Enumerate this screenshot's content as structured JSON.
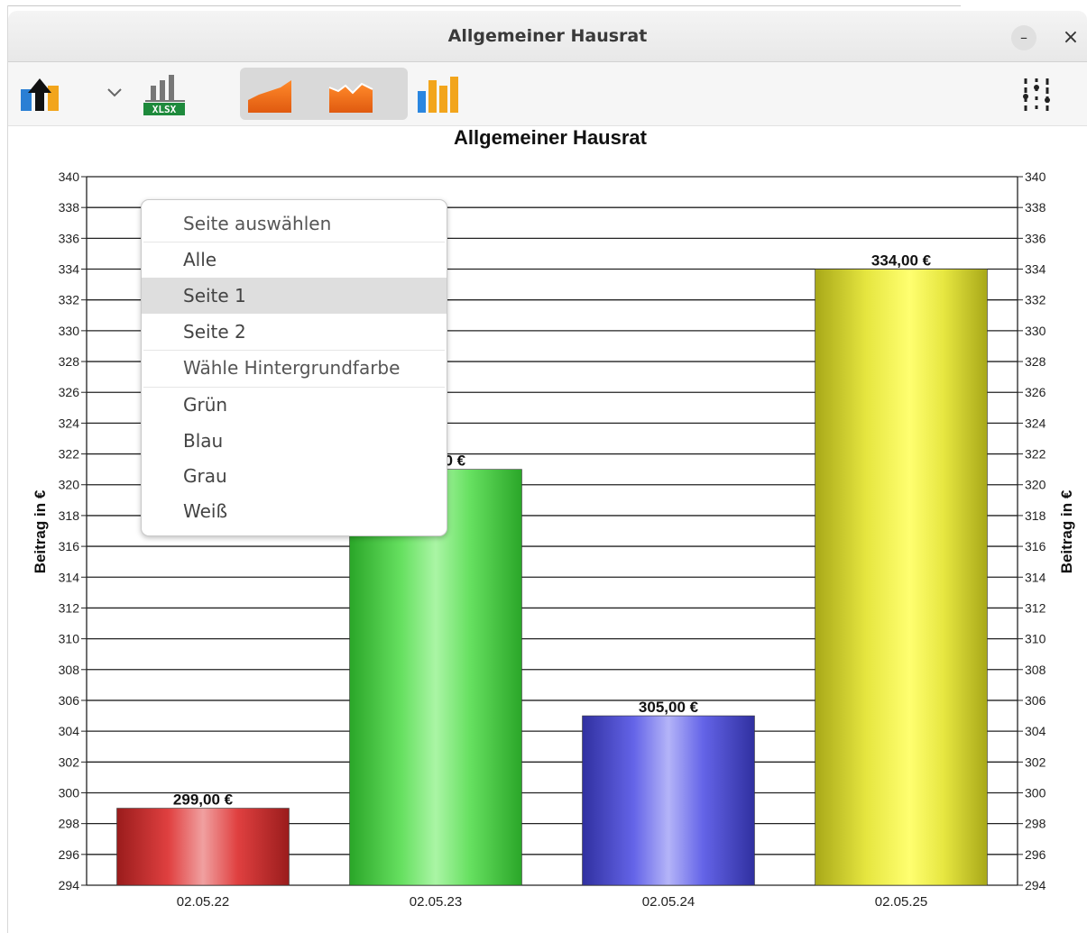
{
  "window": {
    "title": "Allgemeiner Hausrat",
    "minimize_label": "–",
    "close_label": "×"
  },
  "toolbar": {
    "export_icon": "upload-arrow-icon",
    "dropdown_icon": "chevron-down-icon",
    "xlsx_badge": "XLSX",
    "area_chart_icon": "area-chart-icon",
    "area_chart2_icon": "area-chart-variant-icon",
    "bar_chart_icon": "bar-chart-icon",
    "settings_icon": "sliders-icon"
  },
  "context_menu": {
    "header_page": "Seite auswählen",
    "items_page": [
      "Alle",
      "Seite  1",
      "Seite  2"
    ],
    "highlighted": "Seite  1",
    "header_color": "Wähle Hintergrundfarbe",
    "items_color": [
      "Grün",
      "Blau",
      "Grau",
      "Weiß"
    ]
  },
  "chart_data": {
    "type": "bar",
    "title": "Allgemeiner Hausrat",
    "ylabel": "Beitrag in €",
    "ylabel_right": "Beitrag in €",
    "categories": [
      "02.05.22",
      "02.05.23",
      "02.05.24",
      "02.05.25"
    ],
    "values": [
      299,
      321,
      305,
      334
    ],
    "data_labels": [
      "299,00 €",
      "321,00 €",
      "305,00 €",
      "334,00 €"
    ],
    "ylim": [
      294,
      340
    ],
    "yticks": [
      294,
      296,
      298,
      300,
      302,
      304,
      306,
      308,
      310,
      312,
      314,
      316,
      318,
      320,
      322,
      324,
      326,
      328,
      330,
      332,
      334,
      336,
      338,
      340
    ],
    "grid": true,
    "colors": [
      "#d43030",
      "#44d63c",
      "#4a4ad8",
      "#e8e820"
    ]
  }
}
